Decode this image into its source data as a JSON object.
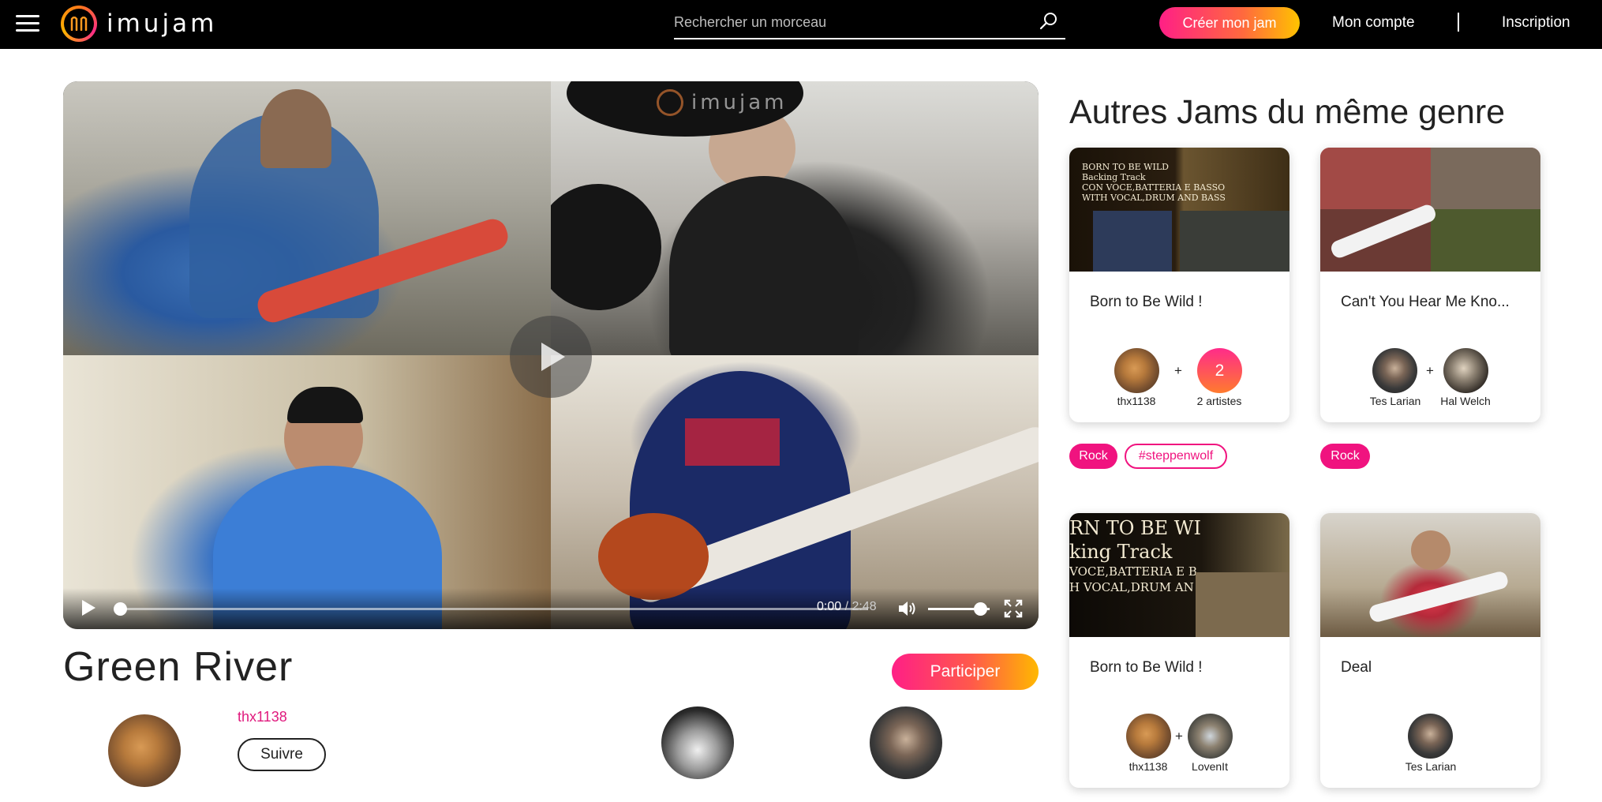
{
  "header": {
    "logo_text": "imujam",
    "search_placeholder": "Rechercher un morceau",
    "create_label": "Créer mon jam",
    "account_label": "Mon compte",
    "signup_label": "Inscription"
  },
  "player": {
    "watermark": "imujam",
    "current_time": "0:00",
    "duration": "2:48",
    "progress": 0,
    "volume": 0.85
  },
  "song": {
    "title": "Green River",
    "participate_label": "Participer",
    "owner": "thx1138",
    "follow_label": "Suivre"
  },
  "sidebar": {
    "title": "Autres Jams du même genre",
    "cards": [
      {
        "title": "Born to Be Wild !",
        "thumb_text": [
          "BORN TO BE WILD",
          "Backing Track",
          "CON VOCE,BATTERIA E BASSO",
          "WITH VOCAL,DRUM AND BASS"
        ],
        "artist_1": "thx1138",
        "count": "2",
        "count_label": "2 artistes",
        "tags": [
          "Rock",
          "#steppenwolf"
        ]
      },
      {
        "title": "Can't You Hear Me Kno...",
        "artist_1": "Tes Larian",
        "artist_2": "Hal Welch",
        "tags": [
          "Rock"
        ]
      },
      {
        "title": "Born to Be Wild !",
        "thumb_text": [
          "RN TO BE WI",
          "king Track",
          "VOCE,BATTERIA E B",
          "H VOCAL,DRUM AN"
        ],
        "artist_1": "thx1138",
        "artist_2": "LovenIt"
      },
      {
        "title": "Deal",
        "artist_1": "Tes Larian"
      }
    ]
  },
  "colors": {
    "accent": "#f0137f",
    "gradient_start": "#ff1f86",
    "gradient_end": "#ffc300",
    "topbar": "#000000"
  },
  "icons": [
    "menu-icon",
    "logo-icon",
    "search-icon",
    "play-icon",
    "volume-icon",
    "fullscreen-icon"
  ]
}
